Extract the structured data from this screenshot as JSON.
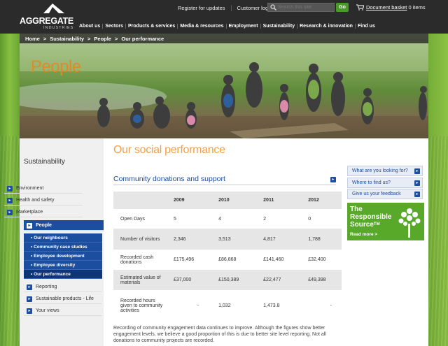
{
  "brand": {
    "name": "AGGREGATE",
    "sub": "INDUSTRIES"
  },
  "toplinks": [
    "Register for updates",
    "Customer login"
  ],
  "search": {
    "placeholder": "Search this site",
    "go": "Go"
  },
  "basket": {
    "label": "Document basket",
    "count": "0 items"
  },
  "nav": [
    "About us",
    "Sectors",
    "Products & services",
    "Media & resources",
    "Employment",
    "Sustainability",
    "Research & innovation",
    "Find us"
  ],
  "breadcrumb": [
    "Home",
    "Sustainability",
    "People",
    "Our performance"
  ],
  "hero": {
    "title": "People"
  },
  "sidebar": {
    "title": "Sustainability",
    "items": [
      "Environment",
      "Health and safety",
      "Marketplace",
      "People"
    ],
    "subitems": [
      "Our neighbours",
      "Community case studies",
      "Employee development",
      "Employee diversity",
      "Our performance"
    ],
    "items2": [
      "Reporting",
      "Sustainable products - Life",
      "Your views"
    ]
  },
  "main": {
    "title": "Our social performance",
    "section": "Community donations and support",
    "table": {
      "headers": [
        "",
        "2009",
        "2010",
        "2011",
        "2012"
      ],
      "rows": [
        [
          "Open Days",
          "5",
          "4",
          "2",
          "0"
        ],
        [
          "Number of visitors",
          "2,346",
          "3,513",
          "4,817",
          "1,788"
        ],
        [
          "Recorded cash donations",
          "£175,496",
          "£86,868",
          "£141,460",
          "£32,400"
        ],
        [
          "Estimated value of materials",
          "£37,000",
          "£150,389",
          "£22,477",
          "£49,398"
        ],
        [
          "Recorded hours given to community activities",
          "-",
          "1,032",
          "1,473.8",
          "-"
        ]
      ]
    },
    "footnote": "Recording of community engagement data continues to improve. Although the figures show better engagement levels, we believe a good proportion of this is due to better site level reporting. Not all donations to community projects are recorded."
  },
  "right": {
    "links": [
      "What are you looking for?",
      "Where to find us?",
      "Give us your feedback"
    ],
    "promo": {
      "line1": "The",
      "line2": "Responsible",
      "line3": "Source",
      "tm": "TM",
      "more": "Read more >"
    }
  },
  "colors": {
    "brand_blue": "#1b4e9e",
    "accent_orange": "#f0a04a",
    "green": "#58a82a"
  }
}
